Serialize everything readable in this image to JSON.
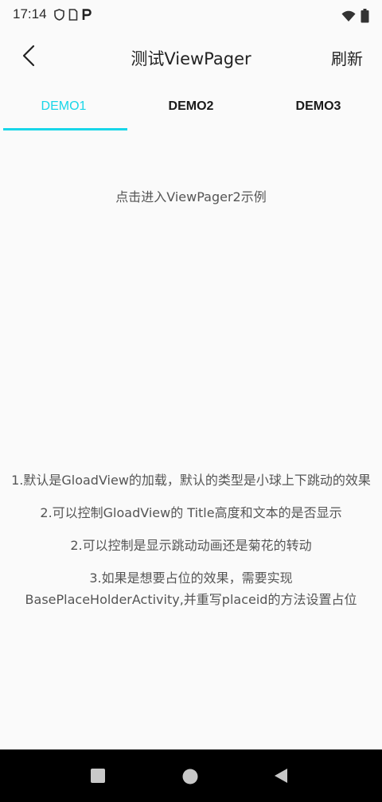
{
  "status_bar": {
    "time": "17:14",
    "icons": [
      "shield-icon",
      "sim-icon",
      "parking-p-icon",
      "wifi-icon",
      "battery-icon"
    ]
  },
  "toolbar": {
    "back_icon": "back-chevron-icon",
    "title": "测试ViewPager",
    "refresh_label": "刷新"
  },
  "tabs": {
    "items": [
      {
        "label": "DEMO1",
        "active": true
      },
      {
        "label": "DEMO2",
        "active": false
      },
      {
        "label": "DEMO3",
        "active": false
      }
    ],
    "accent_color": "#18d6e8"
  },
  "content": {
    "demo_link": "点击进入ViewPager2示例",
    "info_lines": [
      "1.默认是GloadView的加载，默认的类型是小球上下跳动的效果",
      "2.可以控制GloadView的 Title高度和文本的是否显示",
      "2.可以控制是显示跳动动画还是菊花的转动",
      "3.如果是想要占位的效果，需要实现BasePlaceHolderActivity,并重写placeid的方法设置占位"
    ]
  },
  "nav_bar": {
    "buttons": [
      "recents-square-icon",
      "home-circle-icon",
      "back-triangle-icon"
    ]
  }
}
